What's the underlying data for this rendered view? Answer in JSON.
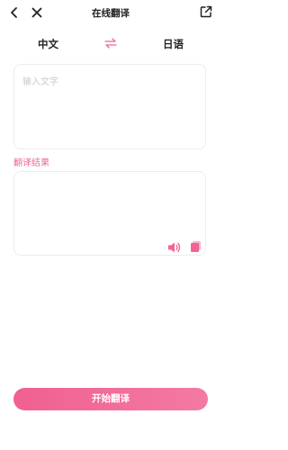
{
  "header": {
    "title": "在线翻译"
  },
  "languages": {
    "source": "中文",
    "target": "日语"
  },
  "input": {
    "placeholder": "输入文字"
  },
  "result": {
    "label": "翻译结果"
  },
  "actions": {
    "start_label": "开始翻译"
  },
  "colors": {
    "accent": "#f06594",
    "border": "#ececec",
    "placeholder": "#c9c9c9"
  }
}
